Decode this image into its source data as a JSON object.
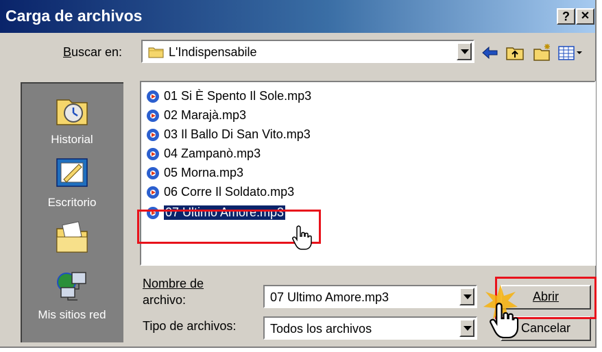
{
  "window": {
    "title": "Carga de archivos",
    "help_label": "?",
    "close_label": "✕"
  },
  "lookin": {
    "label": "Buscar en:",
    "folder": "L'Indispensabile"
  },
  "toolbar": {
    "icons": [
      "back-icon",
      "up-folder-icon",
      "new-folder-icon",
      "view-menu-icon"
    ]
  },
  "places": [
    {
      "label": "Historial",
      "icon": "history-icon"
    },
    {
      "label": "Escritorio",
      "icon": "desktop-icon"
    },
    {
      "label": "",
      "icon": "my-documents-icon"
    },
    {
      "label": "Mis sitios red",
      "icon": "network-places-icon"
    }
  ],
  "files": [
    {
      "name": "01 Si È Spento Il Sole.mp3"
    },
    {
      "name": "02 Marajà.mp3"
    },
    {
      "name": "03 Il Ballo Di San Vito.mp3"
    },
    {
      "name": "04 Zampanò.mp3"
    },
    {
      "name": "05 Morna.mp3"
    },
    {
      "name": "06 Corre Il Soldato.mp3"
    },
    {
      "name": "07 Ultimo Amore.mp3",
      "selected": true
    }
  ],
  "filename": {
    "label_line1": "Nombre de",
    "label_line2": "archivo:",
    "value": "07 Ultimo Amore.mp3"
  },
  "filetype": {
    "label": "Tipo de archivos:",
    "value": "Todos los archivos"
  },
  "buttons": {
    "open": "Abrir",
    "cancel": "Cancelar"
  },
  "colors": {
    "highlight": "#e8121b",
    "selection": "#0a246a",
    "title_bar": "#0a246a"
  }
}
